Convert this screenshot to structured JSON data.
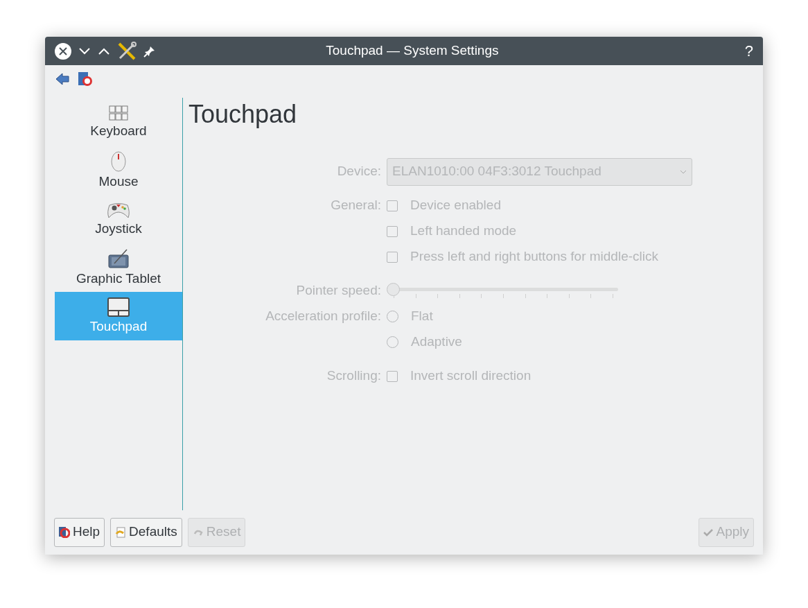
{
  "window": {
    "title": "Touchpad — System Settings",
    "help_glyph": "?"
  },
  "sidebar": {
    "items": [
      {
        "label": "Keyboard",
        "selected": false
      },
      {
        "label": "Mouse",
        "selected": false
      },
      {
        "label": "Joystick",
        "selected": false
      },
      {
        "label": "Graphic Tablet",
        "selected": false
      },
      {
        "label": "Touchpad",
        "selected": true
      }
    ]
  },
  "page": {
    "title": "Touchpad"
  },
  "form": {
    "disabled": true,
    "rows": [
      {
        "kind": "select",
        "label": "Device:",
        "value": "ELAN1010:00 04F3:3012 Touchpad"
      },
      {
        "kind": "checkbox",
        "label": "General:",
        "text": "Device enabled",
        "checked": false
      },
      {
        "kind": "checkbox",
        "text": "Left handed mode",
        "checked": false
      },
      {
        "kind": "checkbox",
        "text": "Press left and right buttons for middle-click",
        "checked": false
      },
      {
        "kind": "slider",
        "label": "Pointer speed:",
        "level": 0
      },
      {
        "kind": "radio",
        "label": "Acceleration profile:",
        "text": "Flat",
        "selected": false
      },
      {
        "kind": "radio",
        "text": "Adaptive",
        "selected": false
      },
      {
        "kind": "checkbox",
        "label": "Scrolling:",
        "text": "Invert scroll direction",
        "checked": false
      }
    ]
  },
  "buttons": [
    {
      "label": "Help",
      "disabled": false
    },
    {
      "label": "Defaults",
      "disabled": false
    },
    {
      "label": "Reset",
      "disabled": true
    },
    {
      "label": "Apply",
      "disabled": true
    }
  ]
}
